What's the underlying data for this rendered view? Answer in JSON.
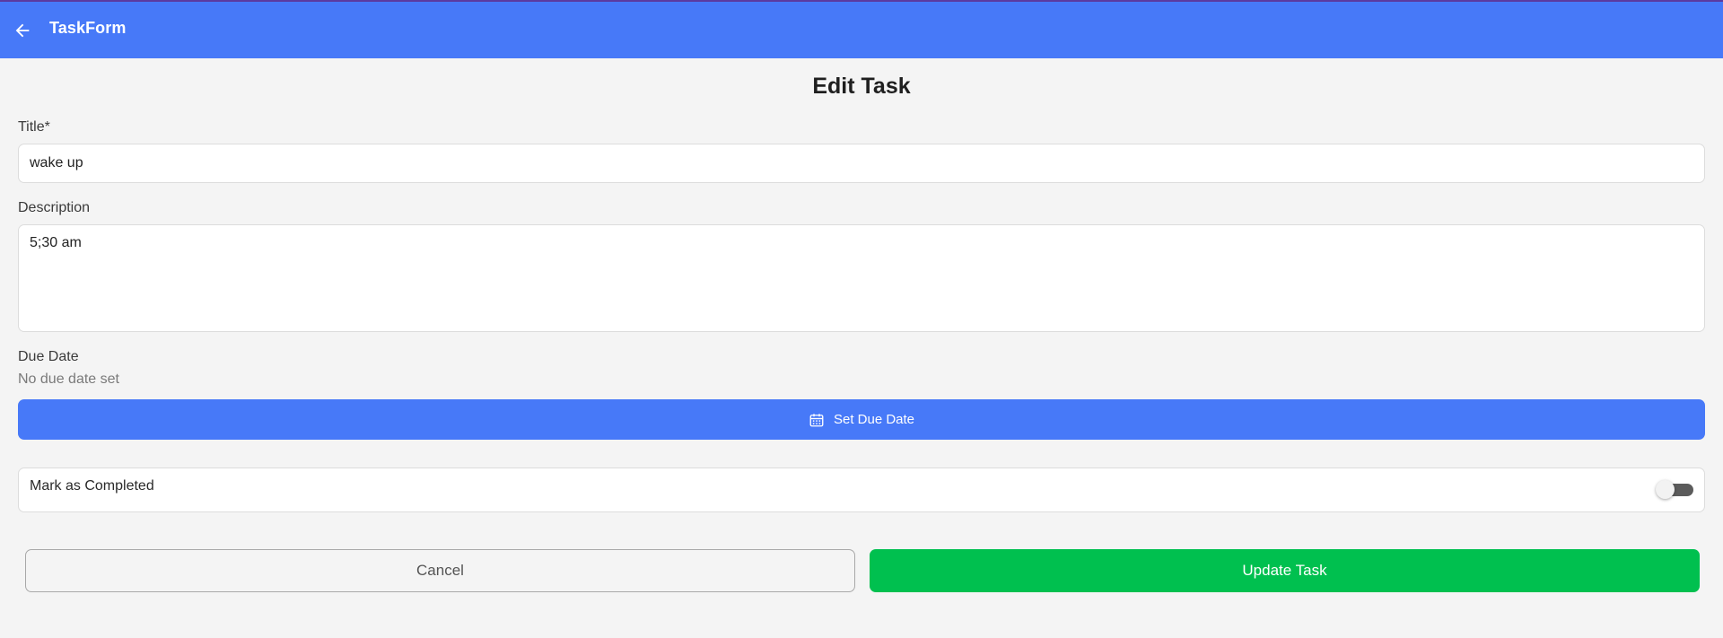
{
  "appbar": {
    "title": "TaskForm",
    "back_icon": "arrow-left-icon"
  },
  "page": {
    "title": "Edit Task"
  },
  "form": {
    "title_label": "Title*",
    "title_value": "wake up",
    "description_label": "Description",
    "description_value": "5;30 am",
    "due_date_label": "Due Date",
    "due_date_hint": "No due date set",
    "set_due_date_label": "Set Due Date",
    "calendar_icon": "calendar-icon",
    "completed_label": "Mark as Completed",
    "completed_value": false
  },
  "actions": {
    "cancel_label": "Cancel",
    "update_label": "Update Task"
  },
  "colors": {
    "primary": "#4779f8",
    "success": "#00c04f",
    "background": "#f4f4f4"
  }
}
